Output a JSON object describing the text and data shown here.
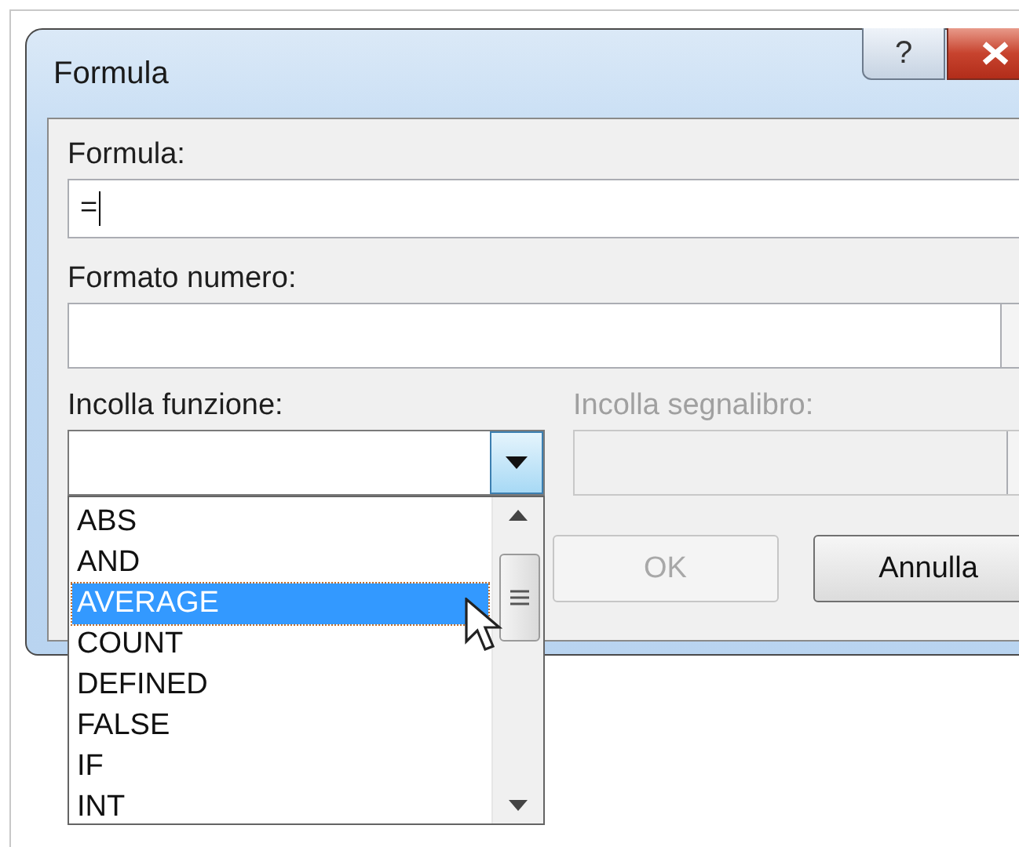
{
  "window": {
    "title": "Formula",
    "help_button": "?"
  },
  "formula": {
    "label": "Formula:",
    "value": "="
  },
  "number_format": {
    "label": "Formato numero:"
  },
  "paste_function": {
    "label": "Incolla funzione:",
    "expanded": true,
    "items": [
      {
        "label": "ABS",
        "selected": false
      },
      {
        "label": "AND",
        "selected": false
      },
      {
        "label": "AVERAGE",
        "selected": true
      },
      {
        "label": "COUNT",
        "selected": false
      },
      {
        "label": "DEFINED",
        "selected": false
      },
      {
        "label": "FALSE",
        "selected": false
      },
      {
        "label": "IF",
        "selected": false
      },
      {
        "label": "INT",
        "selected": false
      }
    ]
  },
  "paste_bookmark": {
    "label": "Incolla segnalibro:",
    "disabled": true
  },
  "buttons": [
    {
      "label": "OK",
      "disabled": true
    },
    {
      "label": "Annulla",
      "disabled": false
    }
  ]
}
